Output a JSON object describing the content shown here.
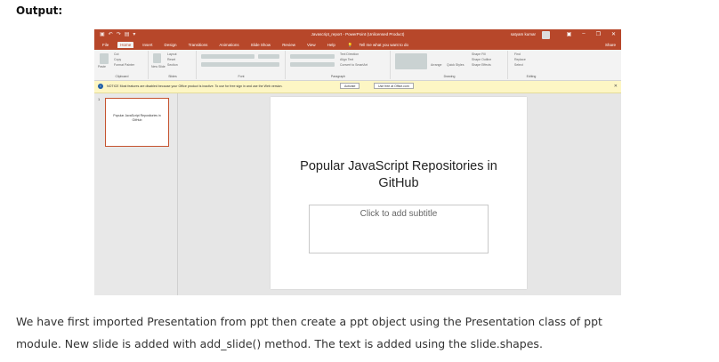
{
  "heading": "Output:",
  "titlebar": {
    "qat_icons": [
      "save-icon",
      "undo-icon",
      "redo-icon",
      "start-icon",
      "customize-icon"
    ],
    "window_title": "Javascript_report - PowerPoint (Unlicensed Product)",
    "user_name": "satyam kumar",
    "window_controls": {
      "minimize": "–",
      "restore": "❐",
      "close": "✕",
      "ribbon_display": "▣"
    }
  },
  "tabs": [
    "File",
    "Home",
    "Insert",
    "Design",
    "Transitions",
    "Animations",
    "Slide Show",
    "Review",
    "View",
    "Help"
  ],
  "active_tab": "Home",
  "tell_me": "Tell me what you want to do",
  "share": "Share",
  "ribbon": {
    "clipboard": {
      "label": "Clipboard",
      "paste": "Paste",
      "cut": "Cut",
      "copy": "Copy",
      "format_painter": "Format Painter"
    },
    "slides": {
      "label": "Slides",
      "new_slide": "New Slide",
      "layout": "Layout",
      "reset": "Reset",
      "section": "Section"
    },
    "font": {
      "label": "Font"
    },
    "paragraph": {
      "label": "Paragraph",
      "text_direction": "Text Direction",
      "align_text": "Align Text",
      "smartart": "Convert to SmartArt"
    },
    "drawing": {
      "label": "Drawing",
      "arrange": "Arrange",
      "quick_styles": "Quick Styles",
      "shape_fill": "Shape Fill",
      "shape_outline": "Shape Outline",
      "shape_effects": "Shape Effects"
    },
    "editing": {
      "label": "Editing",
      "find": "Find",
      "replace": "Replace",
      "select": "Select"
    }
  },
  "notice": {
    "text": "NOTICE  Most features are disabled because your Office product is inactive. To use for free sign in and use the Web version.",
    "activate": "Activate",
    "use_free": "Use free at Office.com"
  },
  "thumbnails": {
    "slide_number": "1",
    "text": "Popular JavaScript Repositories in GitHub"
  },
  "slide": {
    "title": "Popular JavaScript Repositories in GitHub",
    "subtitle_placeholder": "Click to add subtitle"
  },
  "paragraph": {
    "line1": "We have first imported Presentation from ppt then create a ppt object using the Presentation class of ppt",
    "line2": "module. New slide is added with add_slide() method. The text is added using the slide.shapes."
  },
  "colors": {
    "accent": "#b7472a",
    "notice_bg": "#fdf6c4",
    "ribbon_bg": "#f3f3f3"
  }
}
